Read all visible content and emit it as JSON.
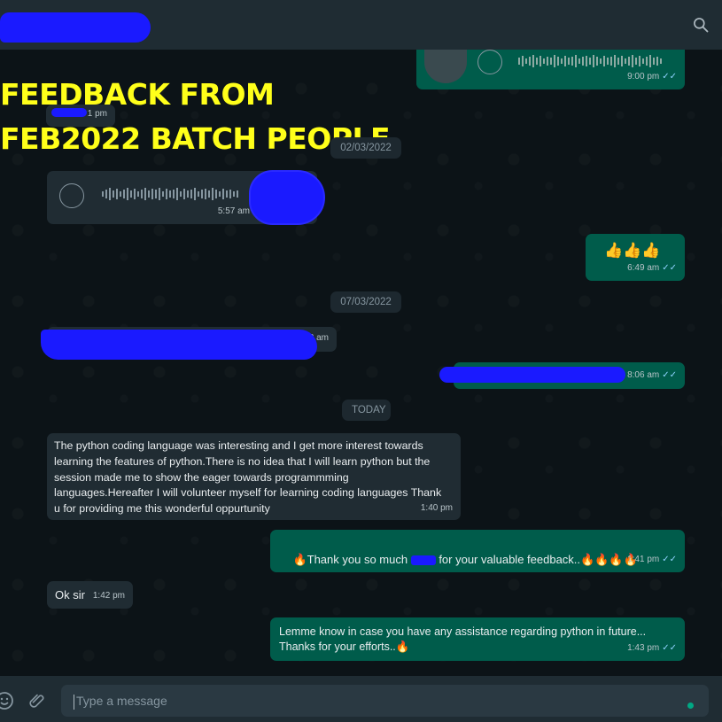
{
  "header": {
    "search_icon": "search-icon"
  },
  "banner": {
    "line1": "FEEDBACK FROM",
    "line2": "FEB2022 BATCH PEOPLE"
  },
  "messages": [
    {
      "id": "voice-out-1",
      "time": "9:00 pm"
    },
    {
      "id": "small-in-1",
      "time": "1 pm"
    },
    {
      "id": "date-1",
      "date": "02/03/2022"
    },
    {
      "id": "voice-in-1",
      "time": "5:57 am"
    },
    {
      "id": "emoji-out",
      "text": "👍👍👍",
      "time": "6:49 am"
    },
    {
      "id": "date-2",
      "date": "07/03/2022"
    },
    {
      "id": "redacted-in",
      "time": "3 am"
    },
    {
      "id": "redacted-out",
      "time": "8:06 am"
    },
    {
      "id": "date-3",
      "date": "TODAY"
    },
    {
      "id": "feedback-in",
      "text": "The python coding language was interesting and I get more interest towards learning the features of python.There is no idea that I will learn python but the session made me to show the eager towards programmming languages.Hereafter I will volunteer myself for learning coding languages Thank u for providing me this wonderful oppurtunity",
      "time": "1:40 pm"
    },
    {
      "id": "thanks-out",
      "text_before": "🔥Thank you so much ",
      "text_after": " for your valuable feedback..🔥🔥🔥🔥",
      "time": "1:41 pm"
    },
    {
      "id": "ok-in",
      "text": "Ok sir",
      "time": "1:42 pm"
    },
    {
      "id": "lemme-out",
      "text": "Lemme know in case you have any assistance regarding python in future...\nThanks for your efforts..🔥",
      "time": "1:43 pm"
    }
  ],
  "composer": {
    "placeholder": "Type a message",
    "emoji_icon": "emoji-icon",
    "attach_icon": "paperclip-icon",
    "mic_indicator": "mic-dot"
  },
  "colors": {
    "incoming": "#202c33",
    "outgoing": "#005c4b",
    "redaction": "#1a1aff",
    "banner": "#ffff1a"
  }
}
